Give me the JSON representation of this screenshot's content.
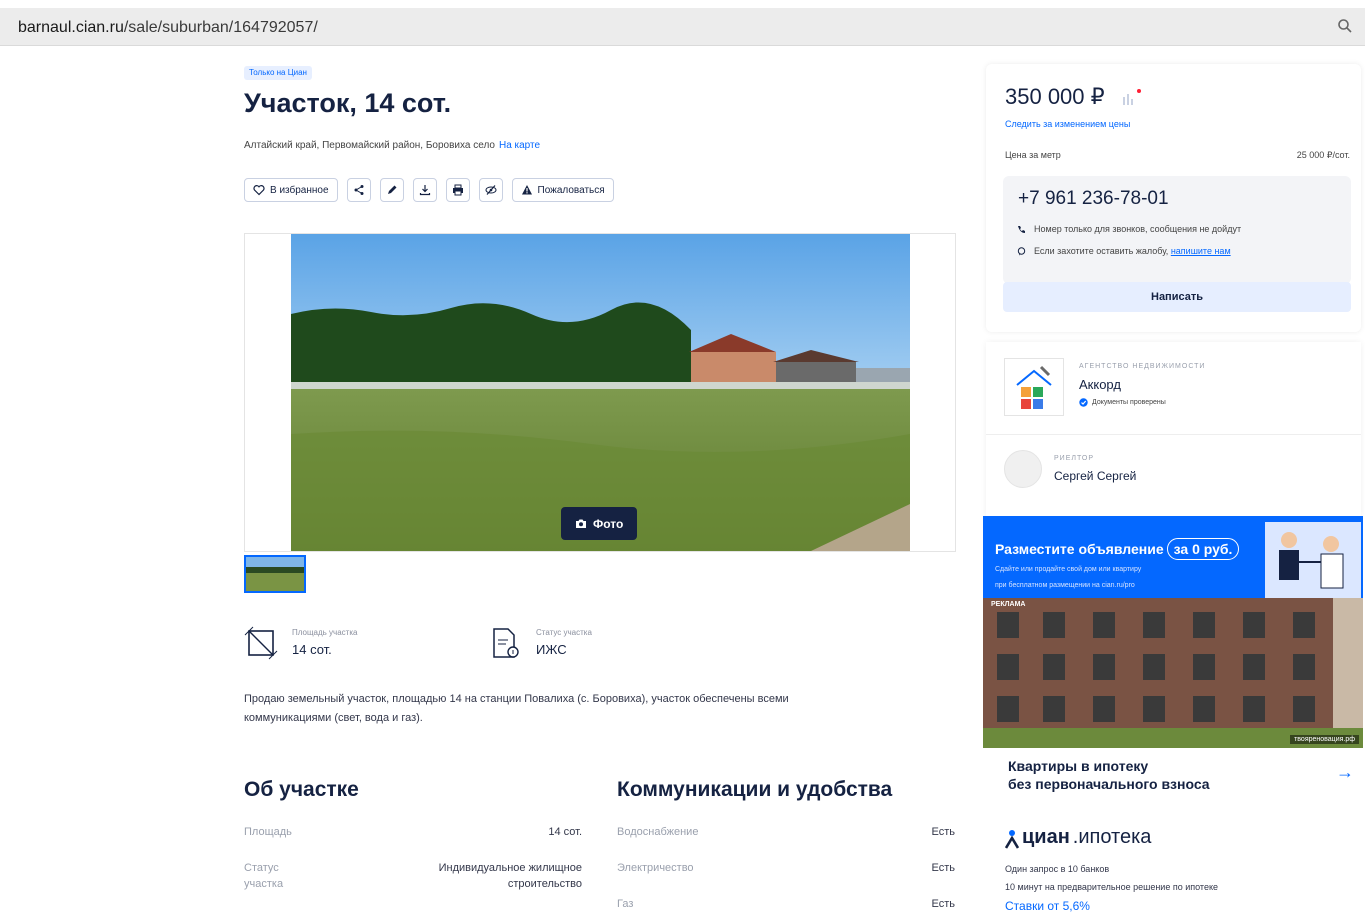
{
  "browser": {
    "url_host": "barnaul.cian.ru",
    "url_path": "/sale/suburban/164792057/"
  },
  "listing": {
    "badge": "Только на Циан",
    "title": "Участок, 14 сот.",
    "address": "Алтайский край, Первомайский район, Боровиха село",
    "map_link": "На карте",
    "toolbar": {
      "favorite": "В избранное",
      "complain": "Пожаловаться"
    },
    "photo_button": "Фото",
    "features": [
      {
        "label": "Площадь участка",
        "value": "14 сот.",
        "icon": "area-icon"
      },
      {
        "label": "Статус участка",
        "value": "ИЖС",
        "icon": "document-status-icon"
      }
    ],
    "description_line1": "Продаю земельный участок, площадью 14 на станции Повалиха (с. Боровиха), участок обеспечены всеми",
    "description_line2": "коммуникациями (свет, вода и газ).",
    "about": {
      "title": "Об участке",
      "rows": [
        {
          "key": "Площадь",
          "value": "14 сот."
        },
        {
          "key_line1": "Статус",
          "key_line2": "участка",
          "value_line1": "Индивидуальное жилищное",
          "value_line2": "строительство"
        }
      ]
    },
    "utilities": {
      "title": "Коммуникации и удобства",
      "rows": [
        {
          "key": "Водоснабжение",
          "value": "Есть"
        },
        {
          "key": "Электричество",
          "value": "Есть"
        },
        {
          "key": "Газ",
          "value": "Есть"
        }
      ]
    }
  },
  "sidebar": {
    "price": "350 000 ₽",
    "follow_price": "Следить за изменением цены",
    "price_per_unit_label": "Цена за метр",
    "price_per_unit_value": "25 000 ₽/сот.",
    "phone": "+7 961 236-78-01",
    "phone_note": "Номер только для звонков, сообщения не дойдут",
    "complaint_note": "Если захотите оставить жалобу,",
    "complaint_link": "напишите нам",
    "write_button": "Написать",
    "agency_type": "АГЕНТСТВО НЕДВИЖИМОСТИ",
    "agency_name": "Аккорд",
    "agency_verified": "Документы проверены",
    "realtor_type": "РИЕЛТОР",
    "realtor_name": "Сергей Сергей"
  },
  "promo": {
    "title": "Разместите объявление",
    "free": "за 0 руб.",
    "sub1": "Сдайте или продайте свой дом или квартиру",
    "sub2": "при бесплатном размещении на cian.ru/pro"
  },
  "ad": {
    "label": "РЕКЛАМА",
    "site": "твояреновация.рф",
    "text_line1": "Квартиры в ипотеку",
    "text_line2": "без первоначального взноса"
  },
  "mortgage": {
    "logo_bold": "циан",
    "logo_light": ".ипотека",
    "line1": "Один запрос в 10 банков",
    "line2": "10 минут на предварительное решение по ипотеке",
    "link": "Ставки от 5,6%"
  },
  "colors": {
    "brand_blue": "#0468ff",
    "text_dark": "#152242"
  }
}
